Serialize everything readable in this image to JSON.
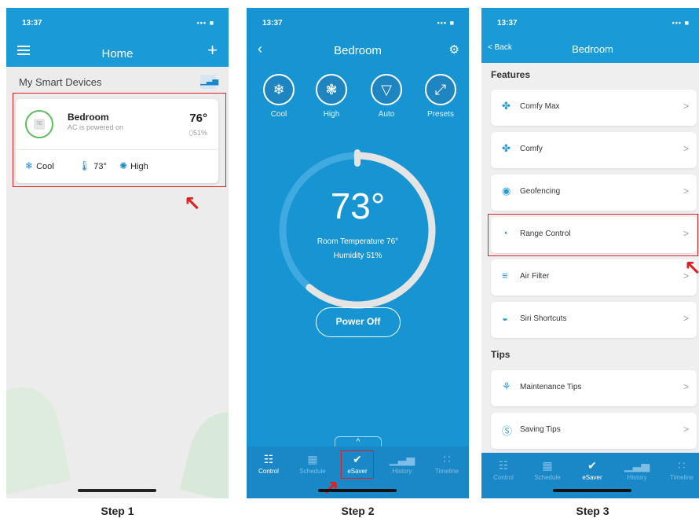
{
  "status_time": "13:37",
  "status_signal": "••• ■",
  "colors": {
    "brand": "#1a9ad6",
    "annotation": "#e02020"
  },
  "step1": {
    "label": "Step 1",
    "title": "Home",
    "menu_icon": "hamburger-icon",
    "add_button": "+",
    "section": "My Smart Devices",
    "chart_icon": "bar-chart-icon",
    "device": {
      "name": "Bedroom",
      "status": "AC is powered on",
      "thumb": "TE",
      "temp": "76°",
      "humidity": "⬯51%",
      "mode": "Cool",
      "setpoint": "73°",
      "fan": "High"
    }
  },
  "step2": {
    "label": "Step 2",
    "title": "Bedroom",
    "modes": [
      {
        "label": "Cool",
        "icon": "❄"
      },
      {
        "label": "High",
        "icon": "❃"
      },
      {
        "label": "Auto",
        "icon": "▽"
      },
      {
        "label": "Presets",
        "icon": "⤢"
      }
    ],
    "setpoint": "73°",
    "setpoint_level": 0.6,
    "room_temp": "Room Temperature 76°",
    "humidity": "Humidity 51%",
    "power_button": "Power Off",
    "tabs": [
      {
        "label": "Control",
        "icon": "☷"
      },
      {
        "label": "Schedule",
        "icon": "▦"
      },
      {
        "label": "eSaver",
        "icon": "✔"
      },
      {
        "label": "History",
        "icon": "▁▃▅"
      },
      {
        "label": "Timeline",
        "icon": "∷"
      }
    ]
  },
  "step3": {
    "label": "Step 3",
    "back": "< Back",
    "title": "Bedroom",
    "features_title": "Features",
    "features": [
      {
        "label": "Comfy Max",
        "icon": "✤"
      },
      {
        "label": "Comfy",
        "icon": "✤"
      },
      {
        "label": "Geofencing",
        "icon": "◉"
      },
      {
        "label": "Range Control",
        "icon": "◔"
      },
      {
        "label": "Air Filter",
        "icon": "≡"
      },
      {
        "label": "Siri Shortcuts",
        "icon": "◒"
      }
    ],
    "tips_title": "Tips",
    "tips": [
      {
        "label": "Maintenance Tips",
        "icon": "⚘"
      },
      {
        "label": "Saving Tips",
        "icon": "Ⓢ"
      }
    ],
    "chevron": ">",
    "tabs": [
      {
        "label": "Control",
        "icon": "☷"
      },
      {
        "label": "Schedule",
        "icon": "▦"
      },
      {
        "label": "eSaver",
        "icon": "✔"
      },
      {
        "label": "History",
        "icon": "▁▃▅"
      },
      {
        "label": "Timeline",
        "icon": "∷"
      }
    ]
  }
}
